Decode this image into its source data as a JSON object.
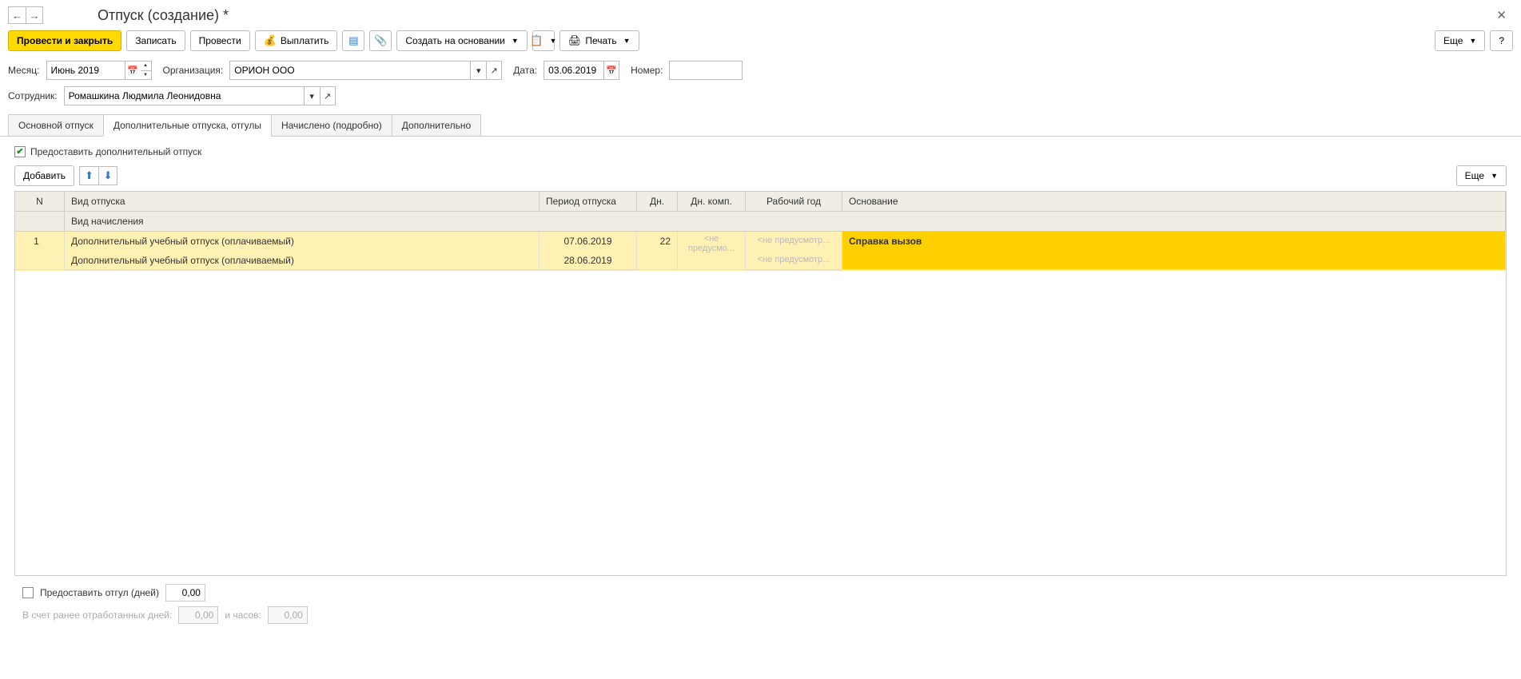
{
  "title": "Отпуск (создание) *",
  "toolbar": {
    "post_close": "Провести и закрыть",
    "save": "Записать",
    "post": "Провести",
    "pay": "Выплатить",
    "create_based": "Создать на основании",
    "print": "Печать",
    "more": "Еще",
    "help": "?"
  },
  "form": {
    "month_label": "Месяц:",
    "month_value": "Июнь 2019",
    "org_label": "Организация:",
    "org_value": "ОРИОН ООО",
    "date_label": "Дата:",
    "date_value": "03.06.2019",
    "number_label": "Номер:",
    "number_value": "",
    "employee_label": "Сотрудник:",
    "employee_value": "Ромашкина Людмила Леонидовна"
  },
  "tabs": {
    "main": "Основной отпуск",
    "additional": "Дополнительные отпуска, отгулы",
    "accrued": "Начислено (подробно)",
    "extra": "Дополнительно"
  },
  "additional_panel": {
    "provide_additional": "Предоставить дополнительный отпуск",
    "add": "Добавить",
    "more": "Еще"
  },
  "grid": {
    "headers": {
      "n": "N",
      "type": "Вид отпуска",
      "calc_type": "Вид начисления",
      "period": "Период отпуска",
      "days": "Дн.",
      "comp": "Дн. комп.",
      "year": "Рабочий год",
      "base": "Основание"
    },
    "row": {
      "n": "1",
      "type": "Дополнительный учебный отпуск (оплачиваемый)",
      "calc_type": "Дополнительный учебный отпуск (оплачиваемый)",
      "period_from": "07.06.2019",
      "period_to": "28.06.2019",
      "days": "22",
      "comp": "<не предусмо...",
      "year1": "<не предусмотр...",
      "year2": "<не предусмотр...",
      "base": "Справка вызов"
    }
  },
  "bottom": {
    "timeoff_label": "Предоставить отгул (дней)",
    "timeoff_value": "0,00",
    "prev_days_label": "В счет ранее отработанных дней:",
    "prev_days_value": "0,00",
    "hours_label": "и часов:",
    "hours_value": "0,00"
  }
}
